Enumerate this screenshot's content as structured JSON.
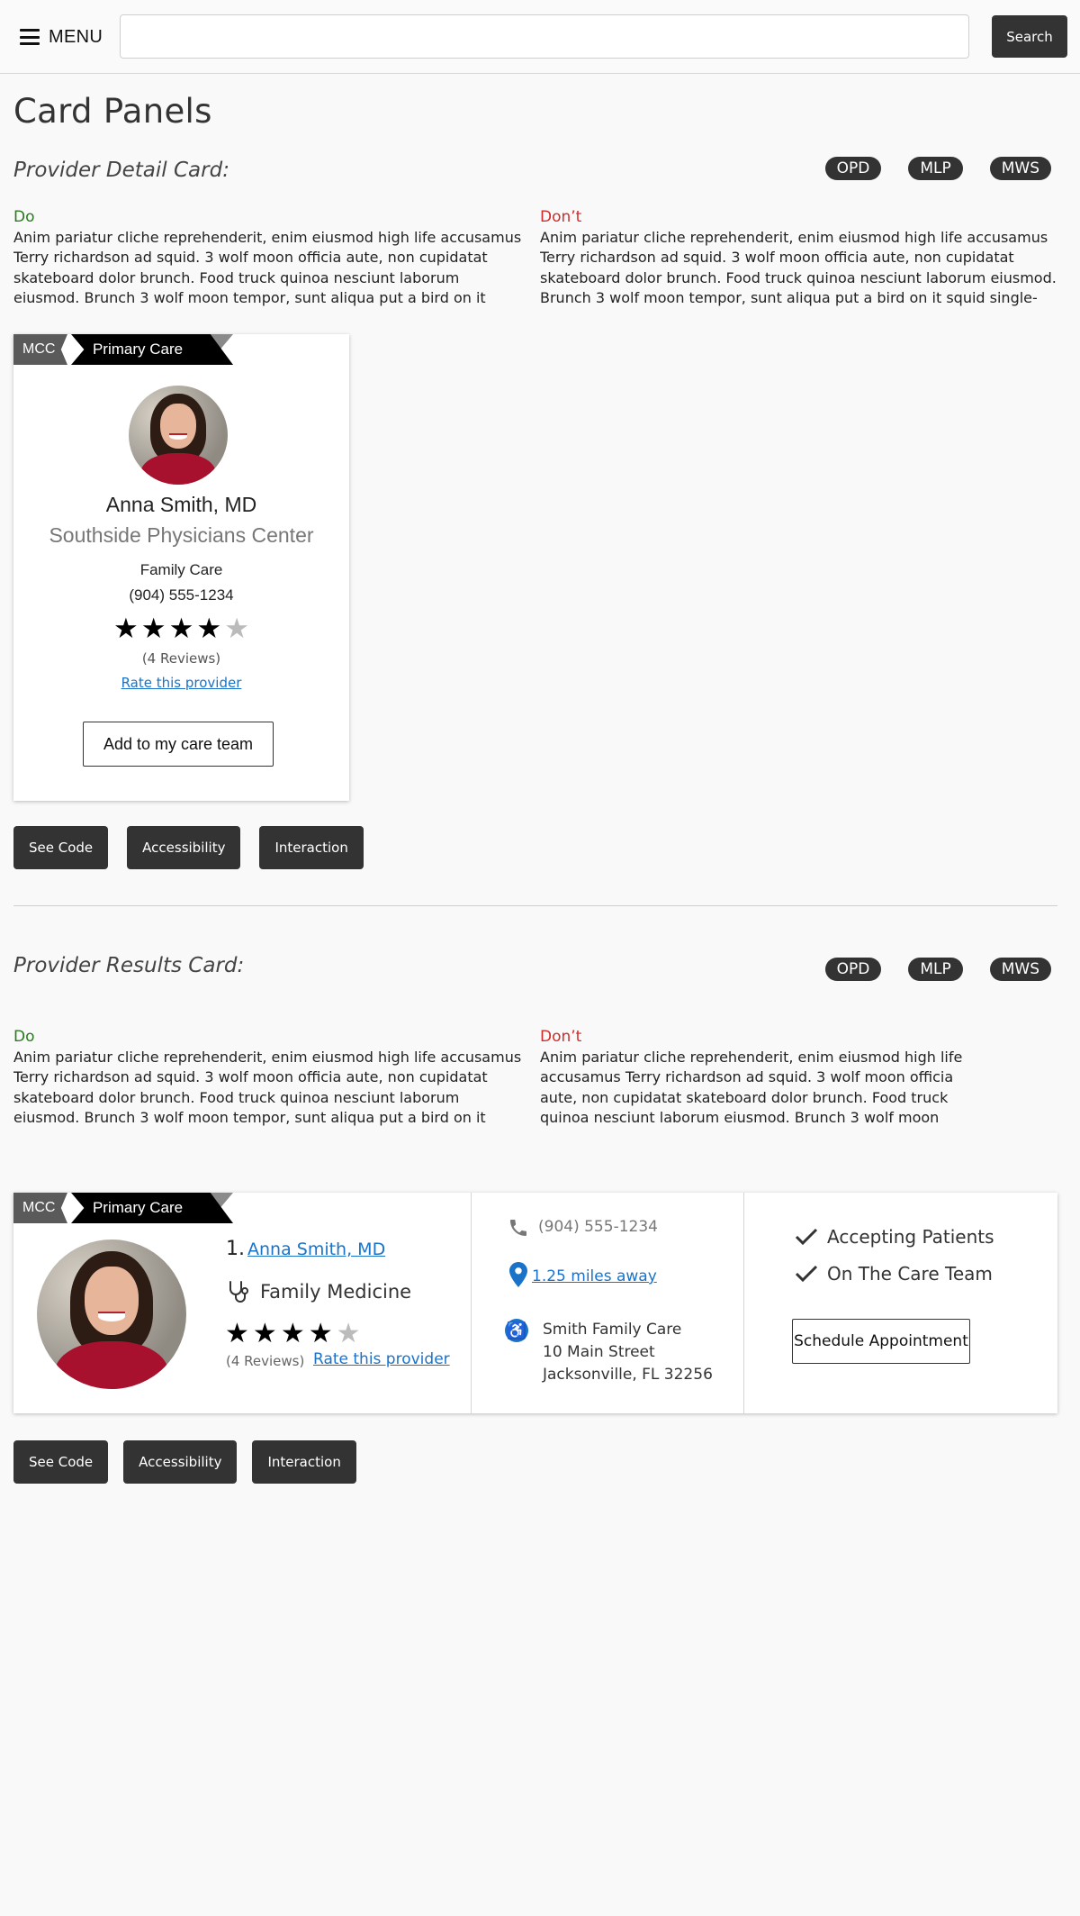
{
  "header": {
    "menu_label": "MENU",
    "search_placeholder": "",
    "search_label": "Search"
  },
  "page": {
    "title": "Card Panels"
  },
  "detail_section": {
    "title": "Provider Detail Card:",
    "tags": [
      "OPD",
      "MLP",
      "MWS"
    ],
    "do_label": "Do",
    "do_text": "Anim pariatur cliche reprehenderit, enim eiusmod high life accusamus Terry richardson ad squid. 3 wolf moon officia aute, non cupidatat skateboard dolor brunch. Food truck quinoa nesciunt laborum eiusmod. Brunch 3 wolf moon tempor, sunt aliqua put a bird on it squid single-",
    "dont_label": "Don’t",
    "dont_text": "Anim pariatur cliche reprehenderit, enim eiusmod high life accusamus Terry richardson ad squid. 3 wolf moon officia aute, non cupidatat skateboard dolor brunch. Food truck quinoa nesciunt laborum eiusmod. Brunch 3 wolf moon tempor, sunt aliqua put a bird on it squid single-origin",
    "card": {
      "ribbon_mcc": "MCC",
      "ribbon_type": "Primary Care",
      "name": "Anna Smith, MD",
      "organization": "Southside Physicians Center",
      "specialty": "Family Care",
      "phone": "(904) 555-1234",
      "rating": 4,
      "rating_max": 5,
      "reviews": "(4 Reviews)",
      "rate_link": "Rate this provider",
      "add_button": "Add to my care team"
    },
    "actions": [
      "See Code",
      "Accessibility",
      "Interaction"
    ]
  },
  "results_section": {
    "title": "Provider Results Card:",
    "tags": [
      "OPD",
      "MLP",
      "MWS"
    ],
    "do_label": "Do",
    "do_text": "Anim pariatur cliche reprehenderit, enim eiusmod high life accusamus Terry richardson ad squid. 3 wolf moon officia aute, non cupidatat skateboard dolor brunch. Food truck quinoa nesciunt laborum eiusmod. Brunch 3 wolf moon tempor, sunt aliqua put a bird on it squid single-",
    "dont_label": "Don’t",
    "dont_text": "Anim pariatur cliche reprehenderit, enim eiusmod high life accusamus Terry richardson ad squid. 3 wolf moon officia aute, non cupidatat skateboard dolor brunch. Food truck quinoa nesciunt laborum eiusmod. Brunch 3 wolf moon",
    "card": {
      "ribbon_mcc": "MCC",
      "ribbon_type": "Primary Care",
      "index": "1.",
      "name": "Anna Smith, MD",
      "specialty": "Family Medicine",
      "rating": 4,
      "rating_max": 5,
      "reviews": "(4 Reviews)",
      "rate_link": "Rate this provider",
      "phone": "(904) 555-1234",
      "distance": "1.25 miles away",
      "address_line1": "Smith Family Care",
      "address_line2": "10 Main Street",
      "address_line3": "Jacksonville, FL 32256",
      "status1": "Accepting Patients",
      "status2": "On The Care Team",
      "schedule_button": "Schedule Appointment"
    },
    "actions": [
      "See Code",
      "Accessibility",
      "Interaction"
    ]
  },
  "colors": {
    "dark": "#333333",
    "link": "#1a73c9",
    "do": "#2a7a1f",
    "dont": "#d12b2b",
    "avatar_shirt": "#a8112d"
  },
  "icons": [
    "hamburger-icon",
    "stethoscope-icon",
    "phone-icon",
    "map-pin-icon",
    "accessibility-icon",
    "checkmark-icon",
    "star-icon"
  ]
}
